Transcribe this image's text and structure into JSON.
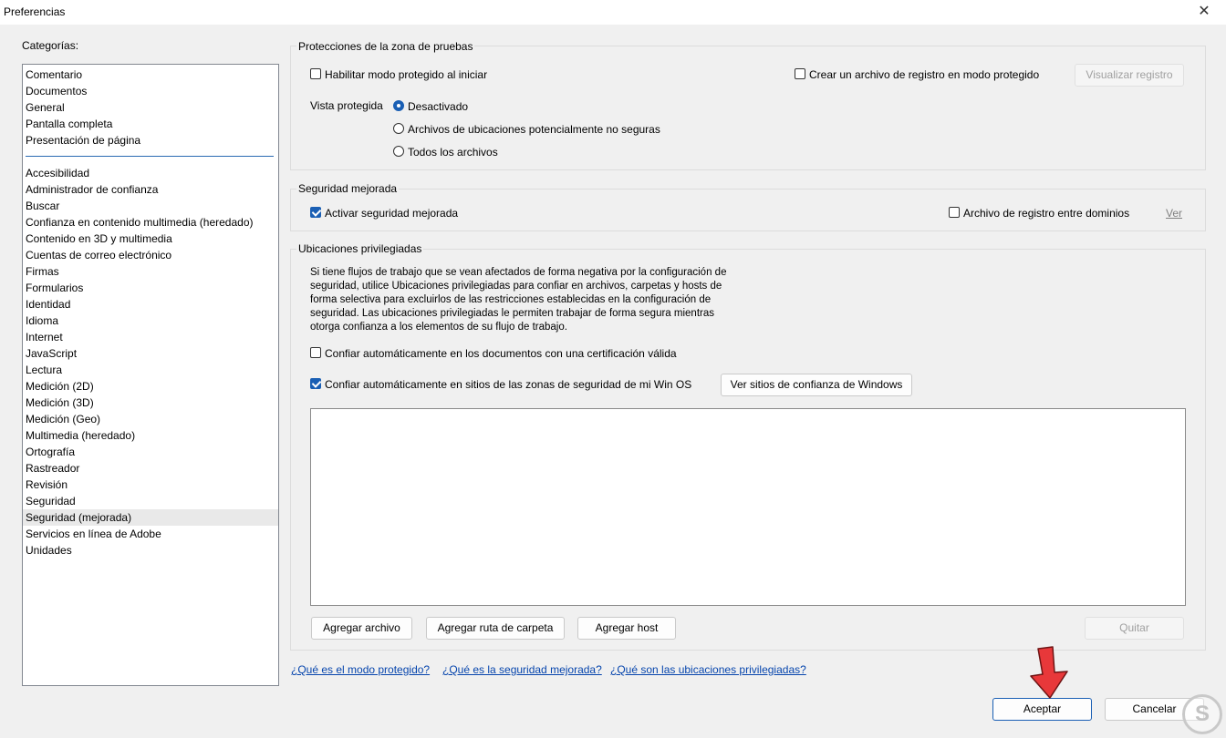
{
  "window": {
    "title": "Preferencias"
  },
  "categories": {
    "label": "Categorías:",
    "group1": [
      "Comentario",
      "Documentos",
      "General",
      "Pantalla completa",
      "Presentación de página"
    ],
    "group2": [
      "Accesibilidad",
      "Administrador de confianza",
      "Buscar",
      "Confianza en contenido multimedia (heredado)",
      "Contenido en 3D y multimedia",
      "Cuentas de correo electrónico",
      "Firmas",
      "Formularios",
      "Identidad",
      "Idioma",
      "Internet",
      "JavaScript",
      "Lectura",
      "Medición (2D)",
      "Medición (3D)",
      "Medición (Geo)",
      "Multimedia (heredado)",
      "Ortografía",
      "Rastreador",
      "Revisión",
      "Seguridad",
      "Seguridad (mejorada)",
      "Servicios en línea de Adobe",
      "Unidades"
    ],
    "selected": "Seguridad (mejorada)"
  },
  "sandbox": {
    "title": "Protecciones de la zona de pruebas",
    "protected_mode_label": "Habilitar modo protegido al iniciar",
    "protected_mode_checked": false,
    "log_file_label": "Crear un archivo de registro en modo protegido",
    "log_file_checked": false,
    "view_log_button": "Visualizar registro",
    "protected_view_label": "Vista protegida",
    "radio_off": "Desactivado",
    "radio_unsafe": "Archivos de ubicaciones potencialmente no seguras",
    "radio_all": "Todos los archivos",
    "selected_radio": "Desactivado"
  },
  "enhanced": {
    "title": "Seguridad mejorada",
    "enable_label": "Activar seguridad mejorada",
    "enable_checked": true,
    "cross_domain_label": "Archivo de registro entre dominios",
    "cross_domain_checked": false,
    "view_link": "Ver"
  },
  "privileged": {
    "title": "Ubicaciones privilegiadas",
    "description_lines": [
      "Si tiene flujos de trabajo que se vean afectados de forma negativa por la configuración de",
      "seguridad, utilice Ubicaciones privilegiadas para confiar en archivos, carpetas y hosts de",
      "forma selectiva para excluirlos de las restricciones establecidas en la configuración de",
      "seguridad. Las ubicaciones privilegiadas le permiten trabajar de forma segura mientras",
      "otorga confianza a los elementos de su flujo de trabajo."
    ],
    "certified_label": "Confiar automáticamente en los documentos con una certificación válida",
    "certified_checked": false,
    "win_zones_label": "Confiar automáticamente en sitios de las zonas de seguridad de mi Win OS",
    "win_zones_checked": true,
    "view_windows_sites_button": "Ver sitios de confianza de Windows",
    "add_file_button": "Agregar archivo",
    "add_folder_button": "Agregar ruta de carpeta",
    "add_host_button": "Agregar host",
    "remove_button": "Quitar"
  },
  "help_links": [
    "¿Qué es el modo protegido?",
    "¿Qué es la seguridad mejorada?",
    "¿Qué son las ubicaciones privilegiadas?"
  ],
  "footer": {
    "ok_button": "Aceptar",
    "cancel_button": "Cancelar"
  },
  "colors": {
    "accent": "#1a5fb4",
    "link": "#0645ad",
    "arrow": "#e8383a"
  },
  "badge": {
    "letter": "S"
  }
}
